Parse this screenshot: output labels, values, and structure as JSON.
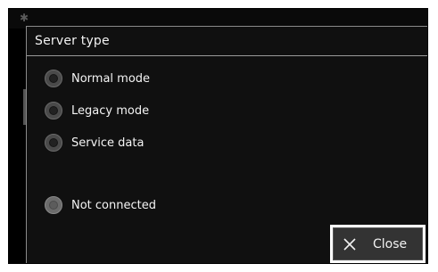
{
  "dialog": {
    "title": "Server type",
    "options": [
      {
        "label": "Normal mode",
        "selected": false,
        "enabled": true
      },
      {
        "label": "Legacy mode",
        "selected": false,
        "enabled": true
      },
      {
        "label": "Service data",
        "selected": false,
        "enabled": true
      },
      {
        "label": "Not connected",
        "selected": false,
        "enabled": false
      }
    ],
    "close_label": "Close"
  },
  "icons": {
    "close": "close-icon",
    "background_settings": "gear-icon"
  }
}
